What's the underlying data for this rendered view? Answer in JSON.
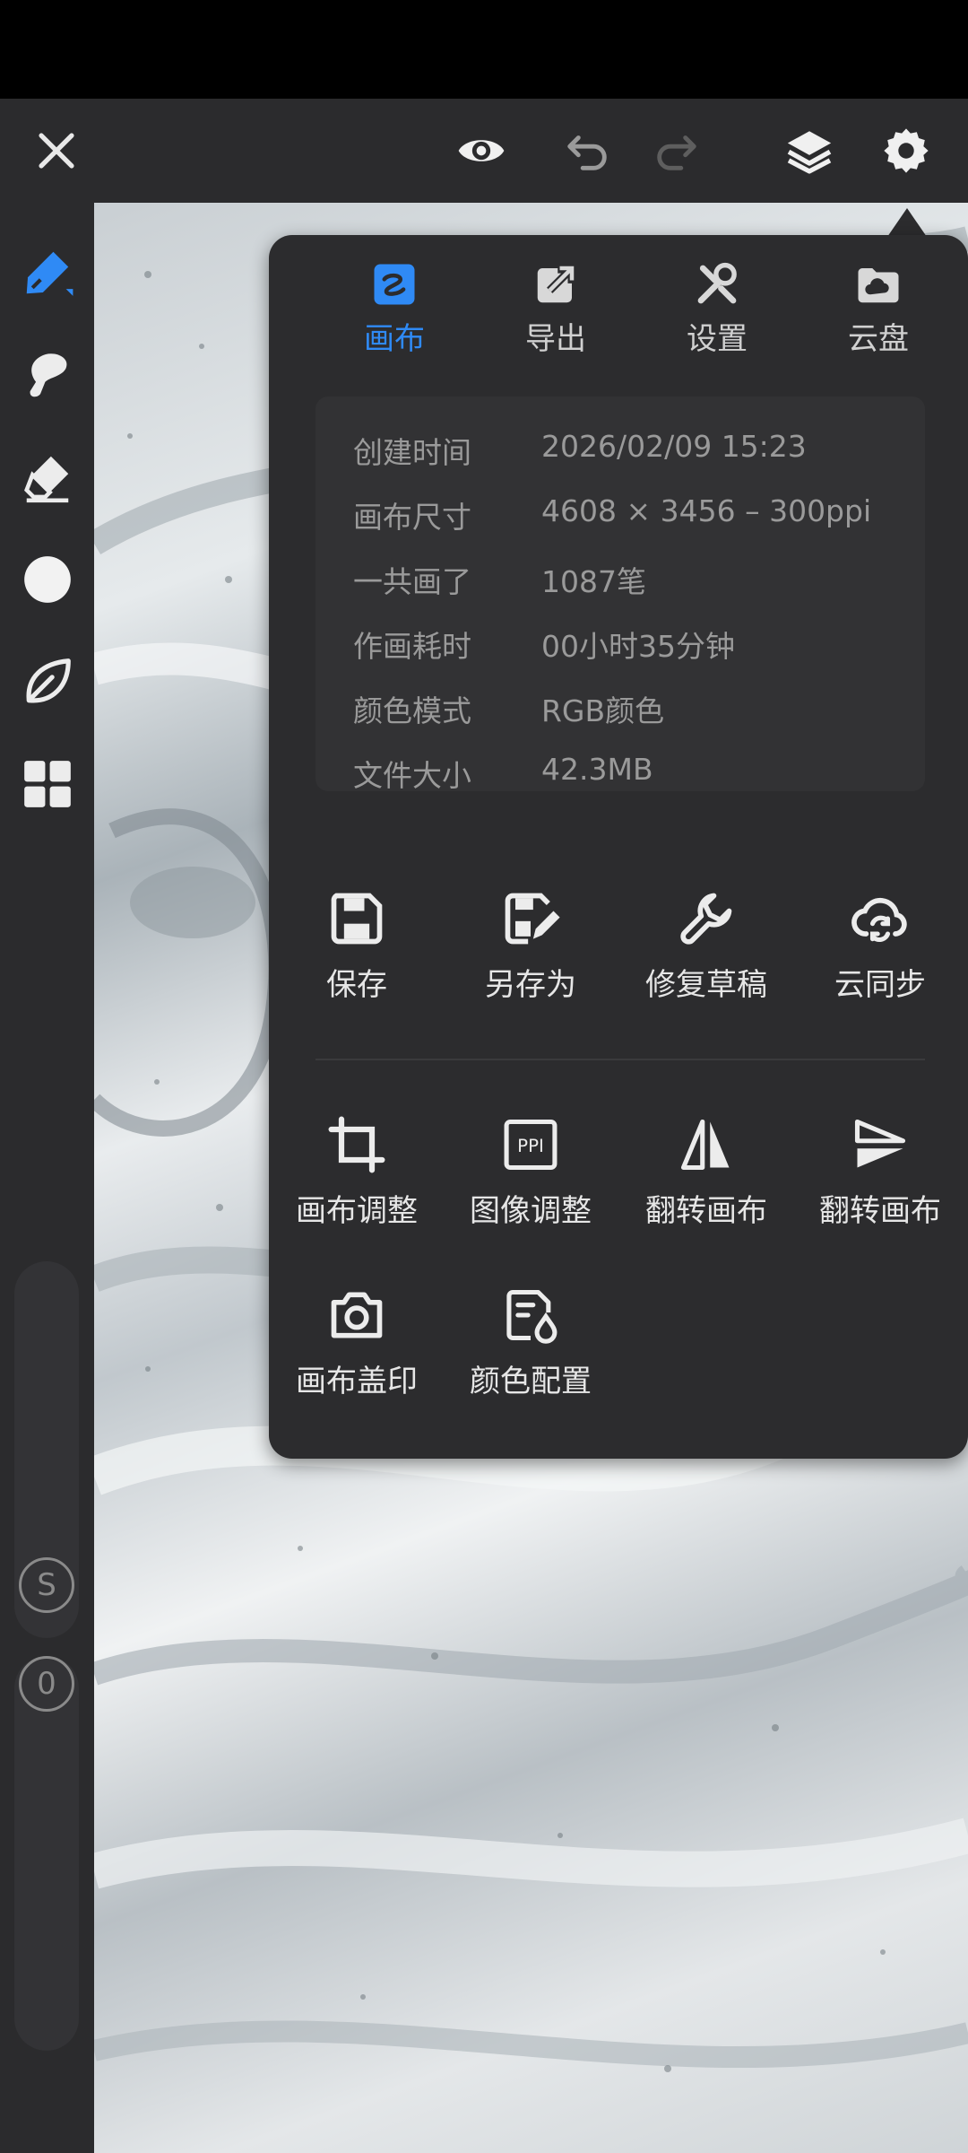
{
  "top_bar": {
    "icons": [
      "close-icon",
      "eye-icon",
      "undo-icon",
      "redo-icon",
      "layers-icon",
      "settings-icon"
    ]
  },
  "left_tools": {
    "icons": [
      "pen-icon",
      "brush-icon",
      "eraser-icon",
      "color-circle-icon",
      "leaf-icon",
      "grid-icon"
    ],
    "slider_size_label": "S",
    "slider_opacity_label": "0"
  },
  "panel": {
    "tabs": [
      {
        "label": "画布",
        "icon": "canvas-icon",
        "active": true
      },
      {
        "label": "导出",
        "icon": "export-icon",
        "active": false
      },
      {
        "label": "设置",
        "icon": "tools-icon",
        "active": false
      },
      {
        "label": "云盘",
        "icon": "cloud-folder-icon",
        "active": false
      }
    ],
    "info": [
      {
        "key": "创建时间",
        "value": "2026/02/09 15:23"
      },
      {
        "key": "画布尺寸",
        "value": "4608 × 3456 – 300ppi"
      },
      {
        "key": "一共画了",
        "value": "1087笔"
      },
      {
        "key": "作画耗时",
        "value": "00小时35分钟"
      },
      {
        "key": "颜色模式",
        "value": "RGB颜色"
      },
      {
        "key": "文件大小",
        "value": "42.3MB"
      }
    ],
    "actions_row1": [
      {
        "label": "保存",
        "icon": "save-icon"
      },
      {
        "label": "另存为",
        "icon": "save-as-icon"
      },
      {
        "label": "修复草稿",
        "icon": "wrench-icon"
      },
      {
        "label": "云同步",
        "icon": "cloud-sync-icon"
      }
    ],
    "actions_row2": [
      {
        "label": "画布调整",
        "icon": "crop-icon"
      },
      {
        "label": "图像调整",
        "icon": "ppi-icon",
        "icon_text": "PPI"
      },
      {
        "label": "翻转画布",
        "icon": "flip-horizontal-icon"
      },
      {
        "label": "翻转画布",
        "icon": "flip-vertical-icon"
      }
    ],
    "actions_row3": [
      {
        "label": "画布盖印",
        "icon": "camera-icon"
      },
      {
        "label": "颜色配置",
        "icon": "color-config-icon"
      }
    ]
  },
  "colors": {
    "accent": "#2f8af5",
    "panel_bg": "#2c2c2e",
    "bar_bg": "#2b2b2d"
  }
}
